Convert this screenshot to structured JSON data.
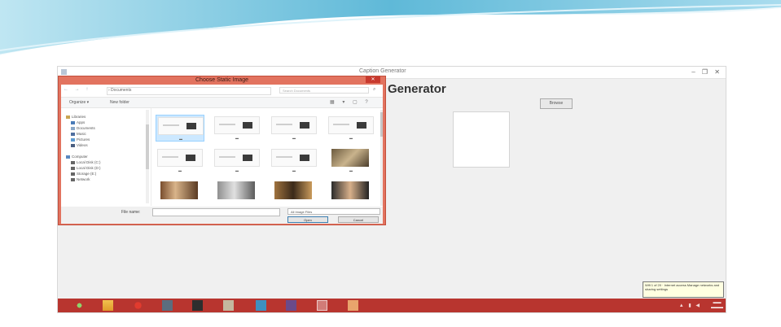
{
  "app": {
    "title": "Caption Generator",
    "heading": "Generator",
    "browse_label": "Browse",
    "window_controls": "– ❐ ✕"
  },
  "dialog": {
    "title": "Choose Static Image",
    "close_label": "✕",
    "nav_arrows": "← → ↑",
    "breadcrumb": "› Documents",
    "search_placeholder": "Search Documents",
    "organize_label": "Organize ▾",
    "newfolder_label": "New folder",
    "nav_items": [
      "Libraries",
      "Apps",
      "Documents",
      "Music",
      "Pictures",
      "Videos",
      "Computer",
      "Local Disk (C:)",
      "Local Disk (D:)",
      "Storage (E:)",
      "Network"
    ],
    "filename_label": "File name:",
    "filetype_label": "All Image Files",
    "open_label": "Open",
    "cancel_label": "Cancel"
  },
  "tooltip": {
    "text": "Wifi 1 of 20 · Internet access Manage networks and sharing settings"
  },
  "colors": {
    "dialog_frame": "#e2735f",
    "taskbar": "#b8352f",
    "selection": "#cce8ff",
    "swoosh": "#6fc3dd"
  }
}
